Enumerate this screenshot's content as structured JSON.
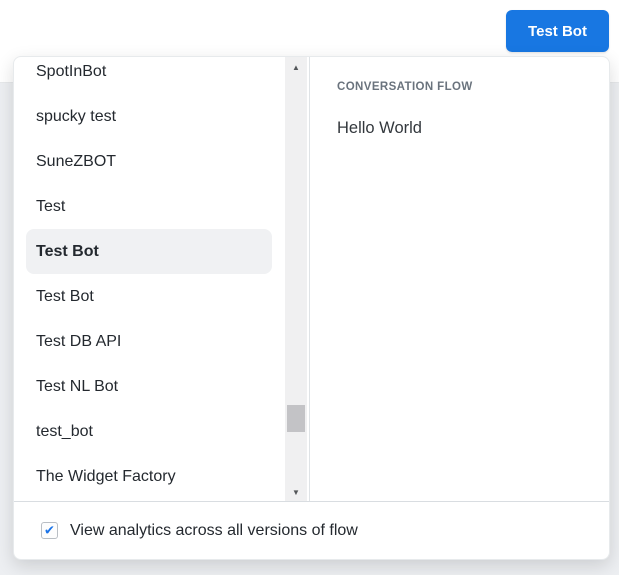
{
  "toolbar": {
    "test_bot_label": "Test Bot"
  },
  "colors": {
    "primary_blue": "#1877e2",
    "check_blue": "#1a73e8",
    "selected_row_bg": "#f0f1f3"
  },
  "bot_list": {
    "items": [
      "SpotInBot",
      "spucky test",
      "SuneZBOT",
      "Test",
      "Test Bot",
      "Test Bot",
      "Test DB API",
      "Test NL Bot",
      "test_bot",
      "The Widget Factory"
    ],
    "selected_index": 4,
    "selected_item": "Test Bot"
  },
  "flow_panel": {
    "header": "CONVERSATION FLOW",
    "flows": [
      "Hello World"
    ]
  },
  "footer": {
    "label": "View analytics across all versions of flow",
    "checked": true
  },
  "icons": {
    "scroll_up": "▲",
    "scroll_down": "▼",
    "check": "✔"
  }
}
